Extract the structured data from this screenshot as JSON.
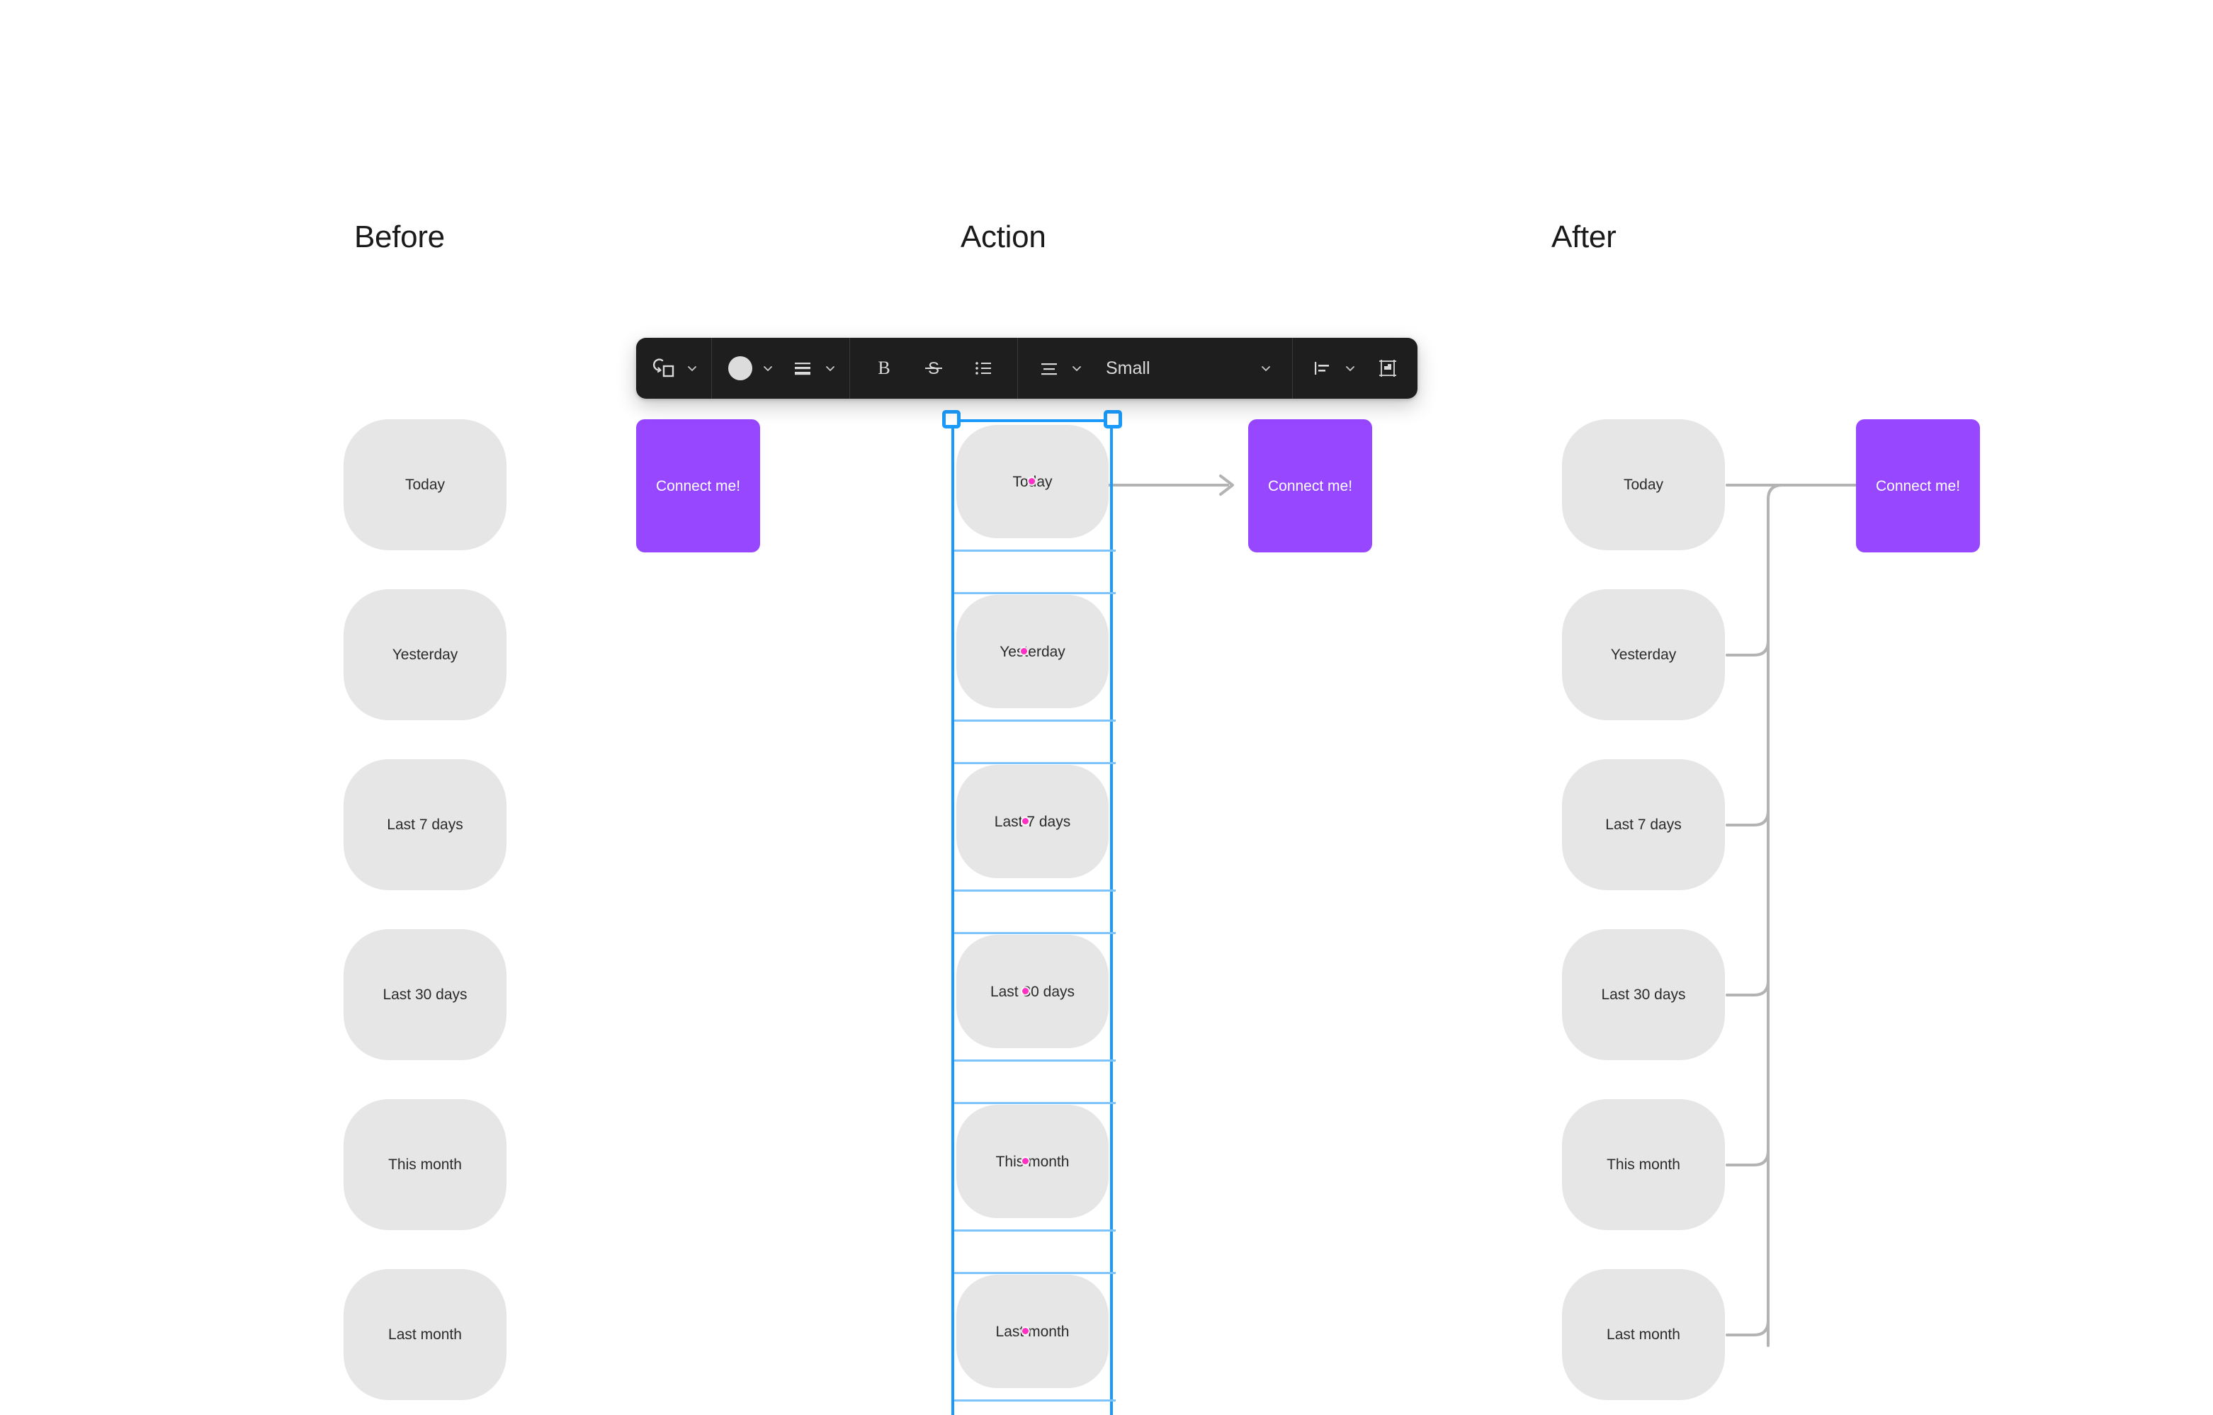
{
  "headings": {
    "before": "Before",
    "action": "Action",
    "after": "After"
  },
  "cards": {
    "labels": [
      "Today",
      "Yesterday",
      "Last 7 days",
      "Last 30 days",
      "This month",
      "Last month"
    ],
    "fill_color": "#e6e6e6",
    "text_color": "#2b2b2b"
  },
  "target_card": {
    "label": "Connect me!",
    "fill_color": "#9747ff",
    "text_color": "#ffffff"
  },
  "toolbar": {
    "background": "#1e1e1e",
    "shape_tool": {
      "icon": "shape-connector-icon",
      "caret": "chevron-down-icon"
    },
    "color_tool": {
      "icon": "color-swatch-icon",
      "swatch_color": "#dcdcdc",
      "caret": "chevron-down-icon"
    },
    "stroke_tool": {
      "icon": "stroke-weight-icon",
      "caret": "chevron-down-icon"
    },
    "bold": {
      "icon": "bold-icon",
      "label": "B"
    },
    "strikethrough": {
      "icon": "strikethrough-icon",
      "label": "S"
    },
    "bullet_list": {
      "icon": "bulleted-list-icon"
    },
    "text_align": {
      "icon": "text-align-icon",
      "caret": "chevron-down-icon"
    },
    "font_size": {
      "value": "Small",
      "caret": "chevron-down-icon"
    },
    "distribute": {
      "icon": "align-left-icon",
      "caret": "chevron-down-icon"
    },
    "fit_frame": {
      "icon": "fit-to-frame-icon"
    }
  },
  "selection": {
    "accent_color": "#1a9bfc",
    "guide_color": "#7cc4fb",
    "cursor_color": "#ff2ec4",
    "handle_fill": "#ffffff"
  },
  "connectors": {
    "stroke_color": "#b3b3b3"
  }
}
